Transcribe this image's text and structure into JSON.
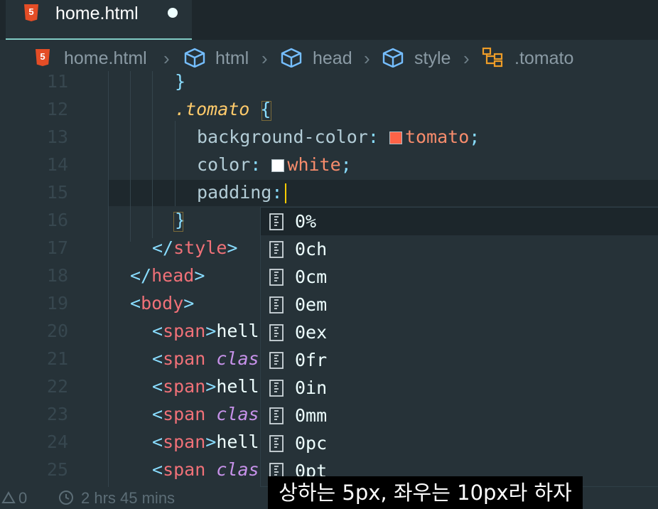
{
  "tab": {
    "label": "home.html",
    "file_icon": "html5-icon",
    "unsaved": true
  },
  "breadcrumb": {
    "file": "home.html",
    "items": [
      "html",
      "head",
      "style",
      ".tomato"
    ],
    "item_icons": [
      "cube-icon",
      "cube-icon",
      "cube-icon",
      "css-rule-icon"
    ]
  },
  "editor": {
    "line_numbers": [
      "11",
      "12",
      "13",
      "14",
      "15",
      "16",
      "17",
      "18",
      "19",
      "20",
      "21",
      "22",
      "23",
      "24",
      "25"
    ],
    "line11": "}",
    "line12": {
      "selector": ".tomato",
      "brace": "{"
    },
    "line13": {
      "prop": "background-color",
      "colon": ":",
      "value": "tomato",
      "semi": ";",
      "swatch_color": "#ff6347"
    },
    "line14": {
      "prop": "color",
      "colon": ":",
      "value": "white",
      "semi": ";",
      "swatch_color": "#ffffff"
    },
    "line15": {
      "prop": "padding",
      "colon": ":"
    },
    "line16": "}",
    "line17": {
      "open": "</",
      "name": "style",
      "close": ">"
    },
    "line18": {
      "open": "</",
      "name": "head",
      "close": ">"
    },
    "line19": {
      "open": "<",
      "name": "body",
      "close": ">"
    },
    "line20": {
      "open": "<",
      "name": "span",
      "close": ">",
      "text": "hell"
    },
    "line21": {
      "open": "<",
      "name": "span",
      "attr": "clas"
    },
    "line22": {
      "open": "<",
      "name": "span",
      "close": ">",
      "text": "hell"
    },
    "line23": {
      "open": "<",
      "name": "span",
      "attr": "clas"
    },
    "line24": {
      "open": "<",
      "name": "span",
      "close": ">",
      "text": "hell"
    },
    "line25": {
      "open": "<",
      "name": "span",
      "attr": "clas"
    }
  },
  "suggestions": {
    "items": [
      "0%",
      "0ch",
      "0cm",
      "0em",
      "0ex",
      "0fr",
      "0in",
      "0mm",
      "0pc",
      "0pt"
    ],
    "item_icon": "unit-ruler-icon",
    "selected_index": 0
  },
  "statusbar": {
    "problems": "0",
    "time": "2 hrs 45 mins"
  },
  "subtitle": "상하는 5px, 좌우는 10px라 하자"
}
